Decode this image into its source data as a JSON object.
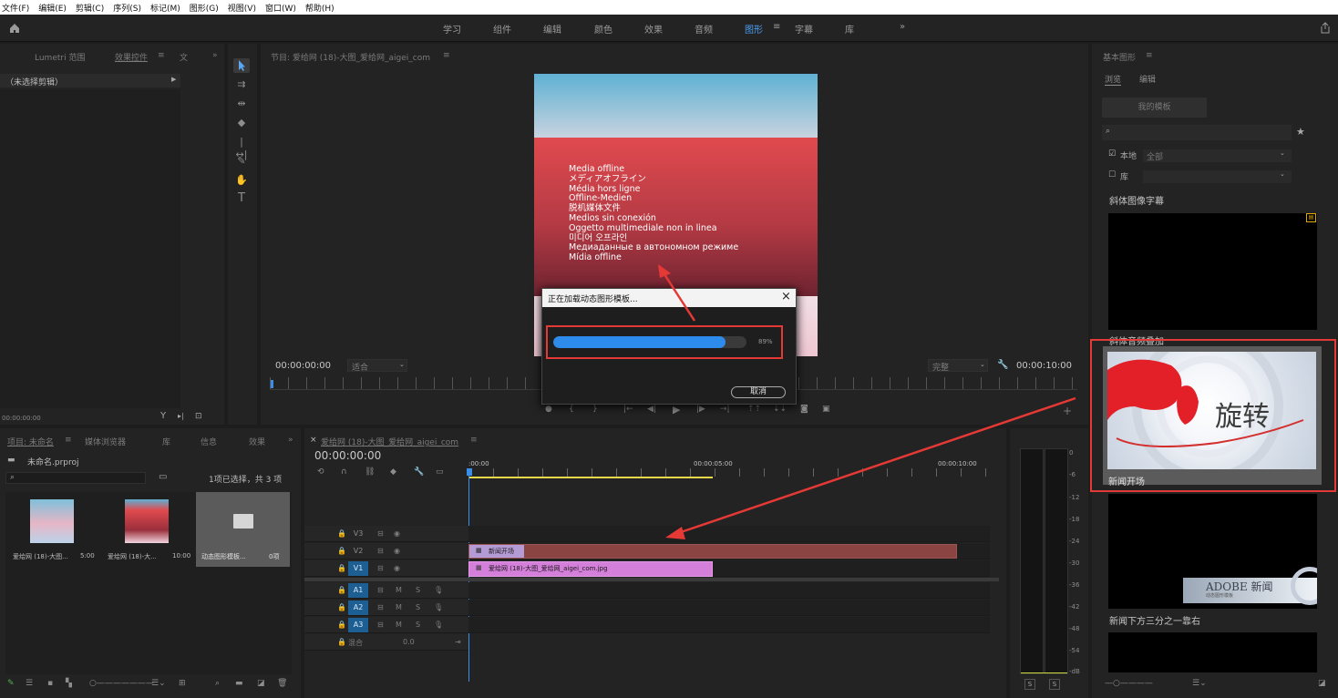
{
  "menu": [
    "文件(F)",
    "编辑(E)",
    "剪辑(C)",
    "序列(S)",
    "标记(M)",
    "图形(G)",
    "视图(V)",
    "窗口(W)",
    "帮助(H)"
  ],
  "workspace": {
    "tabs": [
      "学习",
      "组件",
      "编辑",
      "颜色",
      "效果",
      "音频",
      "图形",
      "字幕",
      "库"
    ],
    "active": "图形",
    "overflow": "»"
  },
  "effects_panel": {
    "tabs": [
      "Lumetri 范围",
      "效果控件",
      "文"
    ],
    "no_clip": "（未选择剪辑）",
    "timecode": "00:00:00:00"
  },
  "program": {
    "title": "节目: 爱给网 (18)-大图_爱给网_aigei_com",
    "timecode_left": "00:00:00:00",
    "fit": "适合",
    "quality": "完整",
    "timecode_right": "00:00:10:00",
    "offline_lines": [
      "Media offline",
      "メディアオフライン",
      "Média hors ligne",
      "Offline-Medien",
      "脱机媒体文件",
      "Medios sin conexión",
      "Oggetto multimediale non in linea",
      "미디어 오프라인",
      "Медиаданные в автономном режиме",
      "Mídia offline"
    ]
  },
  "dialog": {
    "title": "正在加载动态图形模板...",
    "close": "×",
    "progress": 0.89,
    "progress_label": "89%",
    "cancel": "取消"
  },
  "project": {
    "tabs": [
      "项目: 未命名",
      "媒体浏览器",
      "库",
      "信息",
      "效果"
    ],
    "file": "未命名.prproj",
    "selection": "1项已选择，共 3 项",
    "items": [
      {
        "name": "爱给网 (18)-大图...",
        "dur": "5:00"
      },
      {
        "name": "爱给网 (18)-大...",
        "dur": "10:00"
      },
      {
        "name": "动态图形模板...",
        "dur": "0项"
      }
    ]
  },
  "timeline": {
    "close": "×",
    "title": "爱给网 (18)-大图_爱给网_aigei_com",
    "timecode": "00:00:00:00",
    "ruler": [
      ":00:00",
      "00:00:05:00",
      "00:00:10:00"
    ],
    "tracks": [
      "V3",
      "V2",
      "V1",
      "A1",
      "A2",
      "A3"
    ],
    "mix_label": "混合",
    "mix_value": "0.0",
    "clip_v2": "新闻开场",
    "clip_v1": "爱给网 (18)-大图_爱给网_aigei_com.jpg"
  },
  "meter": {
    "scale": [
      "0",
      "-6",
      "-12",
      "-18",
      "-24",
      "-30",
      "-36",
      "-42",
      "-48",
      "-54",
      "-dB"
    ],
    "buttons": [
      "S",
      "S"
    ]
  },
  "essential": {
    "title": "基本图形",
    "tabs": [
      "浏览",
      "编辑"
    ],
    "my_templates": "我的模板",
    "local": "本地",
    "local_value": "全部",
    "library": "库",
    "templates": [
      "斜体图像字幕",
      "斜体音频叠加",
      "新闻开场",
      "新闻下方三分之一靠右"
    ],
    "thumb_text": "旋转",
    "lower_third": "ADOBE 新闻",
    "lower_third_sub": "动态图形模板"
  },
  "colors": {
    "accent": "#4e9ff2",
    "annotation": "#e53935",
    "progress": "#2d8ceb",
    "clip_v2": "#8a4442",
    "clip_v1": "#d47fd9"
  }
}
